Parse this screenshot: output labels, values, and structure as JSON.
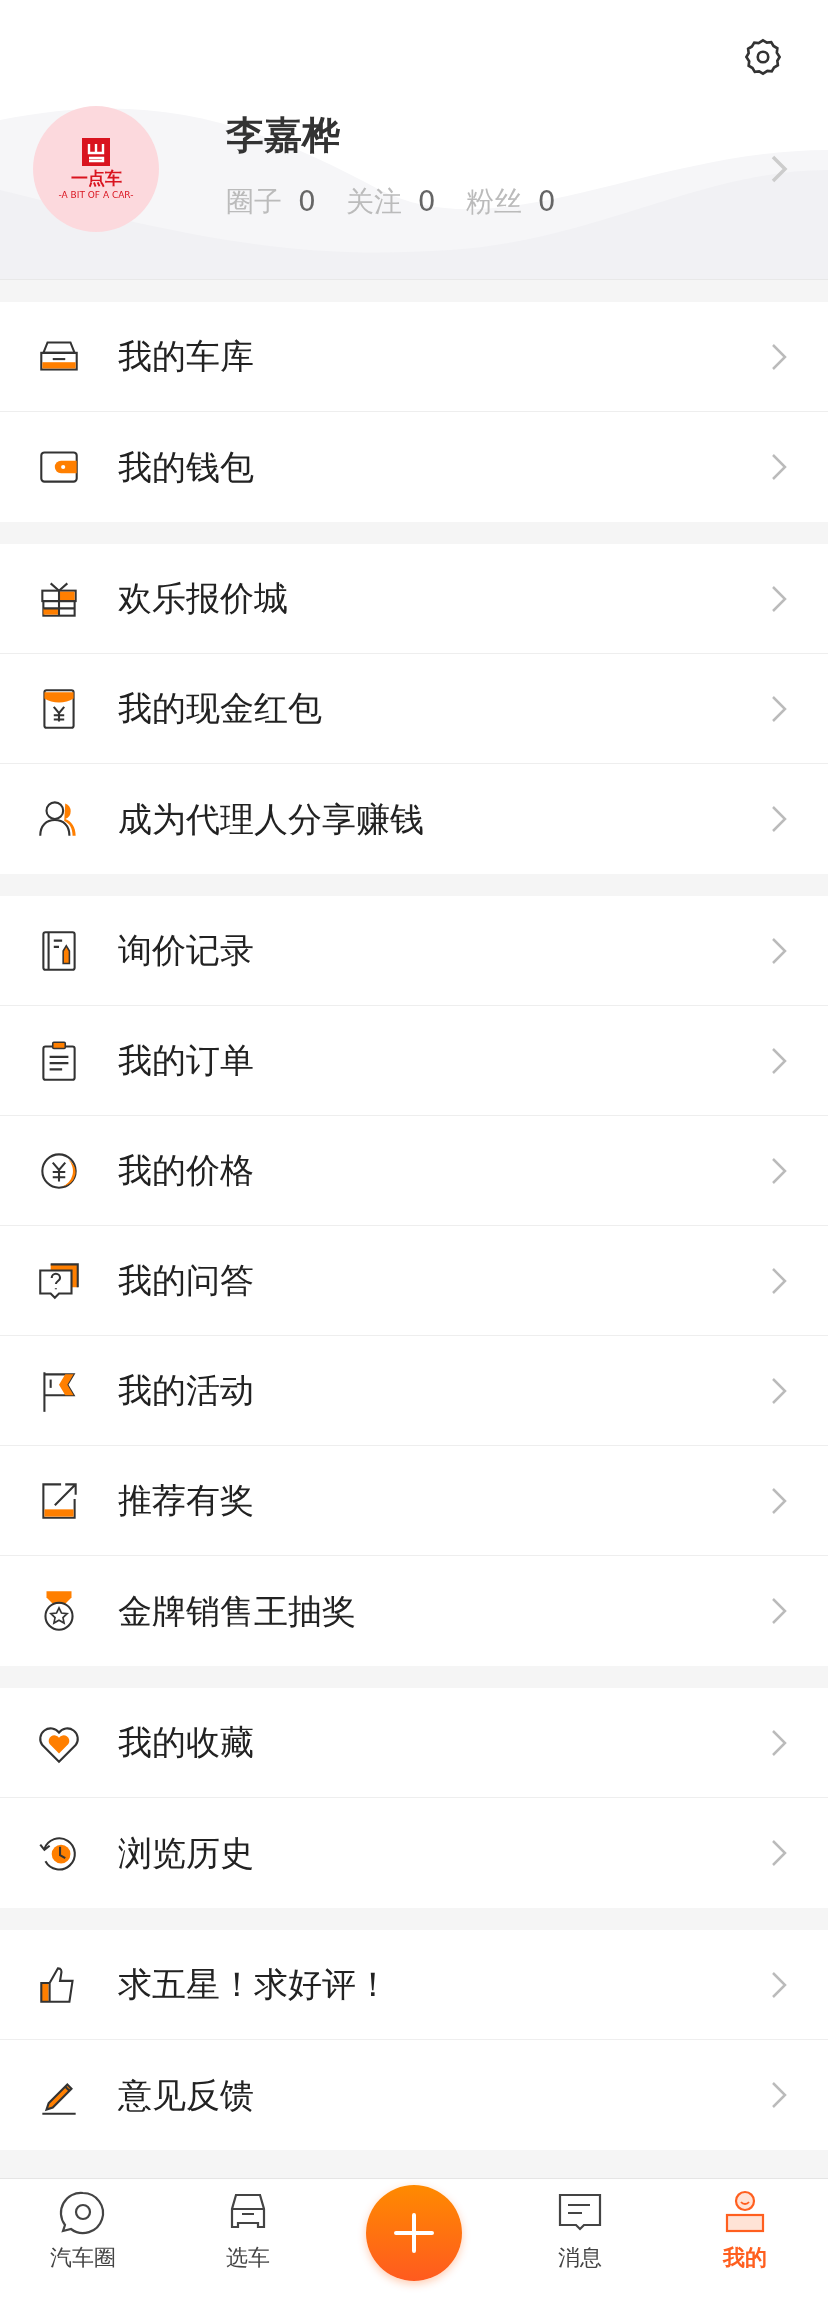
{
  "profile": {
    "logo_text": "一点车",
    "logo_tagline": "-A BIT OF A CAR-",
    "name": "李嘉桦",
    "stats": [
      {
        "label": "圈子",
        "value": "0"
      },
      {
        "label": "关注",
        "value": "0"
      },
      {
        "label": "粉丝",
        "value": "0"
      }
    ]
  },
  "menu_groups": [
    {
      "items": [
        {
          "label": "我的车库"
        },
        {
          "label": "我的钱包"
        }
      ]
    },
    {
      "items": [
        {
          "label": "欢乐报价城"
        },
        {
          "label": "我的现金红包"
        },
        {
          "label": "成为代理人分享赚钱"
        }
      ]
    },
    {
      "items": [
        {
          "label": "询价记录"
        },
        {
          "label": "我的订单"
        },
        {
          "label": "我的价格"
        },
        {
          "label": "我的问答"
        },
        {
          "label": "我的活动"
        },
        {
          "label": "推荐有奖"
        },
        {
          "label": "金牌销售王抽奖"
        }
      ]
    },
    {
      "items": [
        {
          "label": "我的收藏"
        },
        {
          "label": "浏览历史"
        }
      ]
    },
    {
      "items": [
        {
          "label": "求五星！求好评！"
        },
        {
          "label": "意见反馈"
        }
      ]
    }
  ],
  "tab_bar": [
    {
      "kind": "tab",
      "label": "汽车圈",
      "selected": false
    },
    {
      "kind": "tab",
      "label": "选车",
      "selected": false
    },
    {
      "kind": "action"
    },
    {
      "kind": "tab",
      "label": "消息",
      "selected": false
    },
    {
      "kind": "tab",
      "label": "我的",
      "selected": true
    }
  ]
}
